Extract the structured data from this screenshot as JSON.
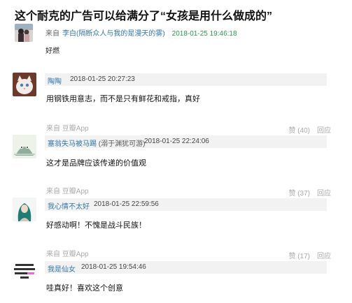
{
  "title": "这个耐克的广告可以给满分了“女孩是用什么做成的”",
  "topic": {
    "from_label": "来自",
    "author": "李白(隔断众人与我的是漫天的雾)",
    "time": "2018-01-25 19:46:18",
    "body": "好燃"
  },
  "comments": [
    {
      "source": "",
      "user": "陶陶",
      "user_suffix": "",
      "time": "2018-01-25 20:27:23",
      "text": "用钢铁用意志，而不是只有鲜花和戒指，真好",
      "like_label": "",
      "reply_label": ""
    },
    {
      "source": "来自 豆瓣App",
      "user": "塞翁失马被马踢",
      "user_suffix": " (溺于渊犹可游)",
      "time": "2018-01-25 22:24:06",
      "text": "这才是品牌应该传递的价值观",
      "like_label": "赞 (40)",
      "reply_label": "回应"
    },
    {
      "source": "来自 豆瓣App",
      "user": "我心情不太好",
      "user_suffix": "",
      "time": "2018-01-25 22:59:56",
      "text": "好感动啊！不愧是战斗民族！",
      "like_label": "赞 (37)",
      "reply_label": "回应"
    },
    {
      "source": "来自 豆瓣App",
      "user": "我是仙女",
      "user_suffix": "",
      "time": "2018-01-25 19:54:46",
      "text": "哇真好！喜欢这个创意",
      "like_label": "赞 (17)",
      "reply_label": "回应"
    }
  ]
}
